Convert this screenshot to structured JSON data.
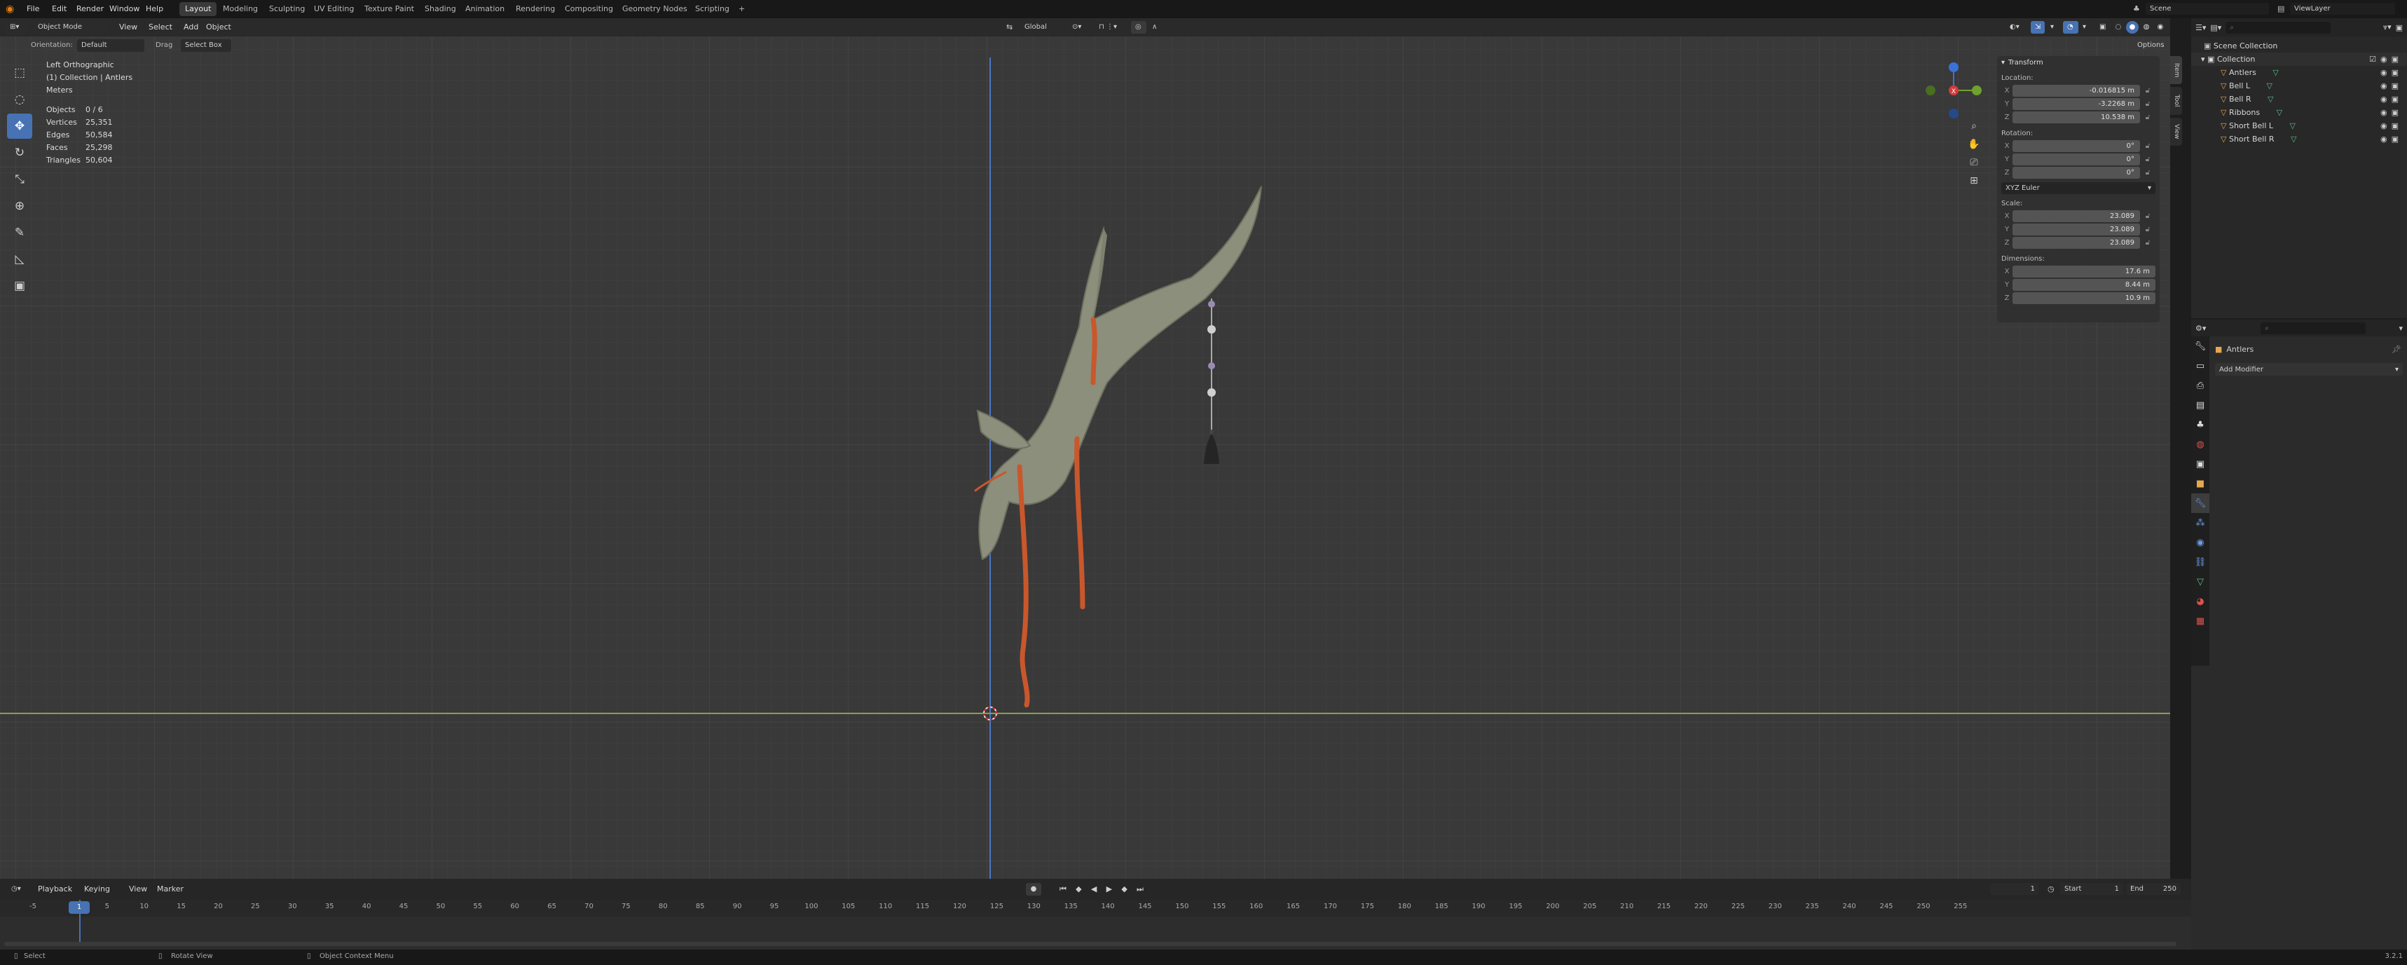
{
  "colors": {
    "accent": "#4772b3",
    "viewport_bg": "#393939",
    "antler": "#8c8f7c",
    "ribbon": "#c9572c",
    "x_axis": "#d43b3b",
    "y_axis": "#6ea22e",
    "z_axis": "#3a72d6"
  },
  "topbar": {
    "menus": [
      "File",
      "Edit",
      "Render",
      "Window",
      "Help"
    ],
    "workspaces": [
      "Layout",
      "Modeling",
      "Sculpting",
      "UV Editing",
      "Texture Paint",
      "Shading",
      "Animation",
      "Rendering",
      "Compositing",
      "Geometry Nodes",
      "Scripting"
    ],
    "active_workspace": "Layout",
    "add_tab": "+",
    "scene": "Scene",
    "viewlayer": "ViewLayer"
  },
  "viewport_header": {
    "mode": "Object Mode",
    "menus": [
      "View",
      "Select",
      "Add",
      "Object"
    ],
    "transform_orientation": "Global",
    "orientation_label": "Orientation:",
    "orientation_value": "Default",
    "drag_label": "Drag",
    "drag_value": "Select Box",
    "options": "Options"
  },
  "viewport_info": {
    "view_name": "Left Orthographic",
    "collection": "(1) Collection | Antlers",
    "units": "Meters",
    "stats": [
      {
        "label": "Objects",
        "value": "0 / 6"
      },
      {
        "label": "Vertices",
        "value": "25,351"
      },
      {
        "label": "Edges",
        "value": "50,584"
      },
      {
        "label": "Faces",
        "value": "25,298"
      },
      {
        "label": "Triangles",
        "value": "50,604"
      }
    ]
  },
  "tools": [
    "select-box",
    "cursor",
    "move",
    "rotate",
    "scale",
    "transform",
    "annotate",
    "measure",
    "add-cube"
  ],
  "npanel": {
    "title": "Transform",
    "location_label": "Location:",
    "location": {
      "x": "-0.016815 m",
      "y": "-3.2268 m",
      "z": "10.538 m"
    },
    "rotation_label": "Rotation:",
    "rotation": {
      "x": "0°",
      "y": "0°",
      "z": "0°"
    },
    "rotation_mode": "XYZ Euler",
    "scale_label": "Scale:",
    "scale": {
      "x": "23.089",
      "y": "23.089",
      "z": "23.089"
    },
    "dimensions_label": "Dimensions:",
    "dimensions": {
      "x": "17.6 m",
      "y": "8.44 m",
      "z": "10.9 m"
    },
    "tabs": [
      "Item",
      "Tool",
      "View"
    ]
  },
  "outliner": {
    "search_placeholder": "",
    "root": "Scene Collection",
    "collection": "Collection",
    "items": [
      "Antlers",
      "Bell L",
      "Bell R",
      "Ribbons",
      "Short Bell L",
      "Short Bell R"
    ]
  },
  "properties": {
    "object_name": "Antlers",
    "add_modifier": "Add Modifier"
  },
  "timeline": {
    "menus": [
      "Playback",
      "Keying",
      "View",
      "Marker"
    ],
    "current_frame": "1",
    "start_label": "Start",
    "start": "1",
    "end_label": "End",
    "end": "250",
    "ruler": [
      "-5",
      "1",
      "5",
      "10",
      "15",
      "20",
      "25",
      "30",
      "35",
      "40",
      "45",
      "50",
      "55",
      "60",
      "65",
      "70",
      "75",
      "80",
      "85",
      "90",
      "95",
      "100",
      "105",
      "110",
      "115",
      "120",
      "125",
      "130",
      "135",
      "140",
      "145",
      "150",
      "155",
      "160",
      "165",
      "170",
      "175",
      "180",
      "185",
      "190",
      "195",
      "200",
      "205",
      "210",
      "215",
      "220",
      "225",
      "230",
      "235",
      "240",
      "245",
      "250",
      "255"
    ]
  },
  "statusbar": {
    "select": "Select",
    "rotate": "Rotate View",
    "context": "Object Context Menu",
    "version": "3.2.1"
  }
}
